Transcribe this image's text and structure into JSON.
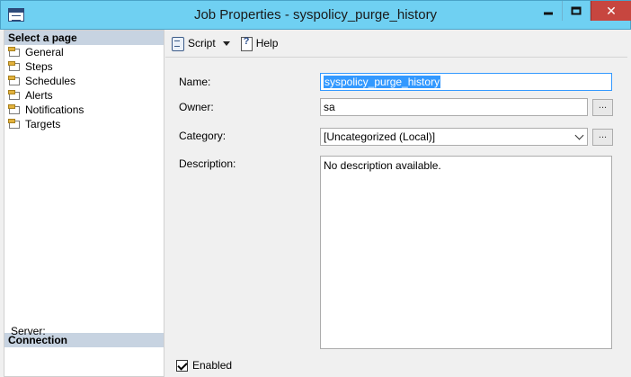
{
  "window": {
    "title": "Job Properties - syspolicy_purge_history",
    "minimize_label": "",
    "close_glyph": "✕"
  },
  "left_pane": {
    "header": "Select a page",
    "pages": [
      {
        "label": "General",
        "icon": "page-icon"
      },
      {
        "label": "Steps",
        "icon": "page-icon"
      },
      {
        "label": "Schedules",
        "icon": "page-icon"
      },
      {
        "label": "Alerts",
        "icon": "page-icon"
      },
      {
        "label": "Notifications",
        "icon": "page-icon"
      },
      {
        "label": "Targets",
        "icon": "page-icon"
      }
    ],
    "connection_header": "Connection",
    "server_label": "Server:"
  },
  "toolbar": {
    "script_label": "Script",
    "help_label": "Help"
  },
  "form": {
    "name_label": "Name:",
    "name_value": "syspolicy_purge_history",
    "owner_label": "Owner:",
    "owner_value": "sa",
    "category_label": "Category:",
    "category_value": "[Uncategorized (Local)]",
    "description_label": "Description:",
    "description_value": "No description available.",
    "browse_label": "...",
    "enabled_label": "Enabled",
    "enabled_checked": true
  },
  "colors": {
    "titlebar": "#6fd0f2",
    "close_button": "#c7463f",
    "pane_header": "#c7d3e1",
    "selection": "#3399ff"
  }
}
